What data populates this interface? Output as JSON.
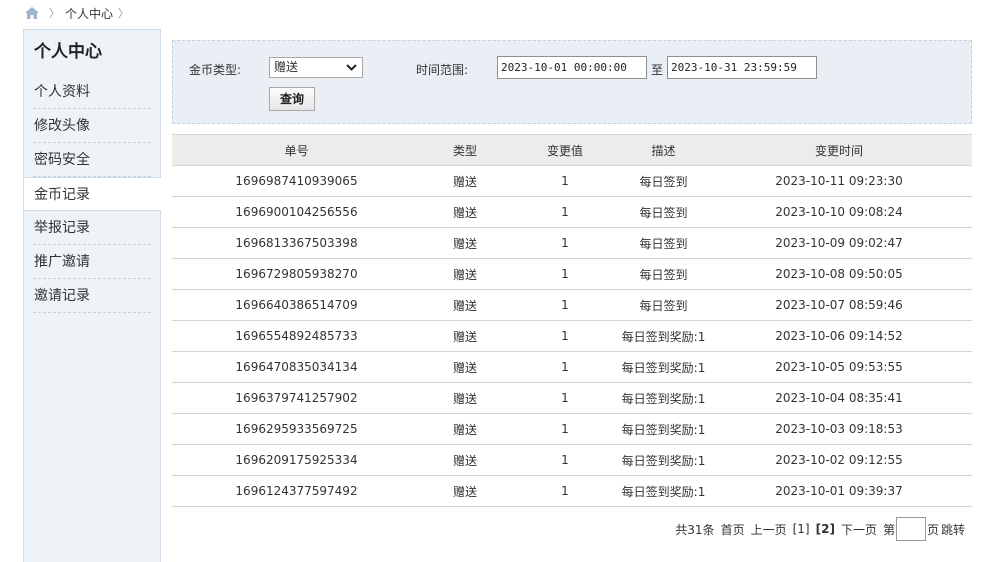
{
  "breadcrumb": {
    "current": "个人中心"
  },
  "sidebar": {
    "title": "个人中心",
    "items": [
      {
        "label": "个人资料"
      },
      {
        "label": "修改头像"
      },
      {
        "label": "密码安全"
      },
      {
        "label": "金币记录"
      },
      {
        "label": "举报记录"
      },
      {
        "label": "推广邀请"
      },
      {
        "label": "邀请记录"
      }
    ],
    "active_index": 3
  },
  "filter": {
    "type_label": "金币类型:",
    "type_value": "赠送",
    "time_label": "时间范围:",
    "start": "2023-10-01 00:00:00",
    "to": "至",
    "end": "2023-10-31 23:59:59",
    "query_label": "查询"
  },
  "table": {
    "headers": [
      "单号",
      "类型",
      "变更值",
      "描述",
      "变更时间"
    ],
    "rows": [
      [
        "1696987410939065",
        "赠送",
        "1",
        "每日签到",
        "2023-10-11 09:23:30"
      ],
      [
        "1696900104256556",
        "赠送",
        "1",
        "每日签到",
        "2023-10-10 09:08:24"
      ],
      [
        "1696813367503398",
        "赠送",
        "1",
        "每日签到",
        "2023-10-09 09:02:47"
      ],
      [
        "1696729805938270",
        "赠送",
        "1",
        "每日签到",
        "2023-10-08 09:50:05"
      ],
      [
        "1696640386514709",
        "赠送",
        "1",
        "每日签到",
        "2023-10-07 08:59:46"
      ],
      [
        "1696554892485733",
        "赠送",
        "1",
        "每日签到奖励:1",
        "2023-10-06 09:14:52"
      ],
      [
        "1696470835034134",
        "赠送",
        "1",
        "每日签到奖励:1",
        "2023-10-05 09:53:55"
      ],
      [
        "1696379741257902",
        "赠送",
        "1",
        "每日签到奖励:1",
        "2023-10-04 08:35:41"
      ],
      [
        "1696295933569725",
        "赠送",
        "1",
        "每日签到奖励:1",
        "2023-10-03 09:18:53"
      ],
      [
        "1696209175925334",
        "赠送",
        "1",
        "每日签到奖励:1",
        "2023-10-02 09:12:55"
      ],
      [
        "1696124377597492",
        "赠送",
        "1",
        "每日签到奖励:1",
        "2023-10-01 09:39:37"
      ]
    ]
  },
  "pager": {
    "total": "共31条",
    "first": "首页",
    "prev": "上一页",
    "page1": "[1]",
    "page2": "[2]",
    "next": "下一页",
    "goto_prefix": "第",
    "goto_suffix": "页",
    "jump": "跳转"
  },
  "colors": {
    "sidebar_bg": "#eef3f8",
    "filter_bg": "#e9eff5",
    "header_bg": "#ececec",
    "home_icon": "#9fb6cc"
  },
  "icons": {
    "home": "home-icon",
    "select_arrow": "chevron-down-icon"
  }
}
